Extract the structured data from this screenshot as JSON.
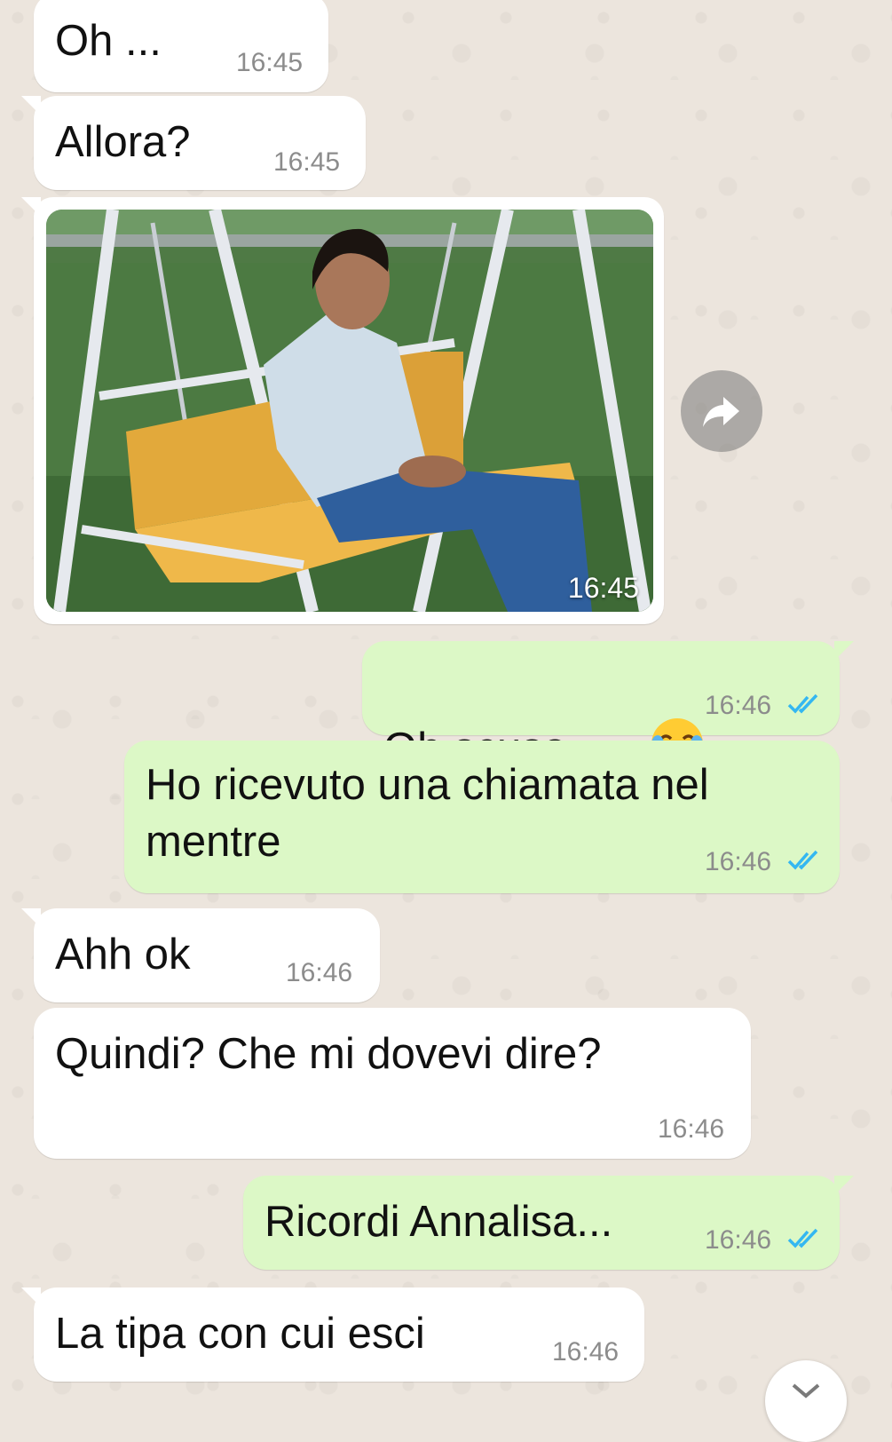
{
  "messages": [
    {
      "text": "Oh ...",
      "time": "16:45"
    },
    {
      "text": "Allora?",
      "time": "16:45"
    },
    {
      "image_alt": "meme: man sitting alone on a yellow garden swing",
      "time": "16:45"
    },
    {
      "text": "Oh scusa",
      "emoji": "face-with-tears-of-joy",
      "time": "16:46",
      "status": "read"
    },
    {
      "text": "Ho ricevuto una chiamata nel\nmentre",
      "time": "16:46",
      "status": "read"
    },
    {
      "text": "Ahh ok",
      "time": "16:46"
    },
    {
      "text": "Quindi? Che mi dovevi dire?",
      "time": "16:46"
    },
    {
      "text": "Ricordi Annalisa...",
      "time": "16:46",
      "status": "read"
    },
    {
      "text": "La tipa con cui esci",
      "time": "16:46"
    }
  ],
  "icons": {
    "forward": "forward-arrow-icon",
    "scroll_down": "chevron-down-icon",
    "read_receipt": "double-check-icon"
  },
  "colors": {
    "incoming_bubble": "#ffffff",
    "outgoing_bubble": "#dcf8c6",
    "read_ticks": "#34b7f1",
    "wallpaper": "#ece5dd"
  }
}
